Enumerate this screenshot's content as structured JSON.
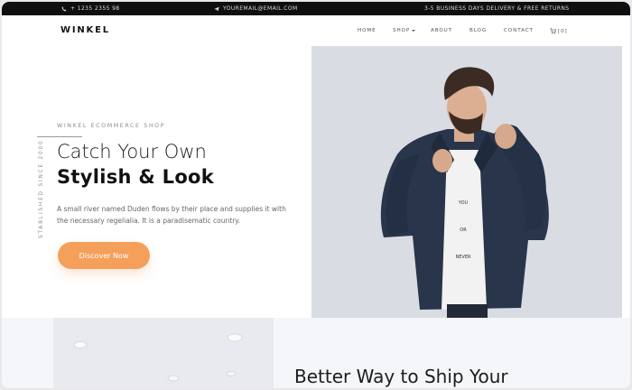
{
  "topbar": {
    "phone": "+ 1235 2355 98",
    "email": "YOUREMAIL@EMAIL.COM",
    "shipping": "3-5 BUSINESS DAYS DELIVERY & FREE RETURNS",
    "icons": [
      "phone-icon",
      "paper-plane-icon"
    ]
  },
  "navbar": {
    "logo": "WINKEL",
    "items": [
      "HOME",
      "SHOP",
      "ABOUT",
      "BLOG",
      "CONTACT"
    ],
    "cart_count": "[0]",
    "cart_icon": "cart-icon"
  },
  "hero": {
    "eyebrow": "WINKEL ECOMMERCE SHOP",
    "vertical_text": "STABLISHED SINCE 2000",
    "title_line1": "Catch Your Own",
    "title_line2": "Stylish & Look",
    "description": "A small river named Duden flows by their place and supplies it with the necessary regelialia. It is a paradisematic country.",
    "cta_label": "Discover Now"
  },
  "section2": {
    "title": "Better Way to Ship Your"
  },
  "colors": {
    "accent": "#f5a05a",
    "topbar_bg": "#0f0f10",
    "hero_image_bg": "#dadee4"
  }
}
